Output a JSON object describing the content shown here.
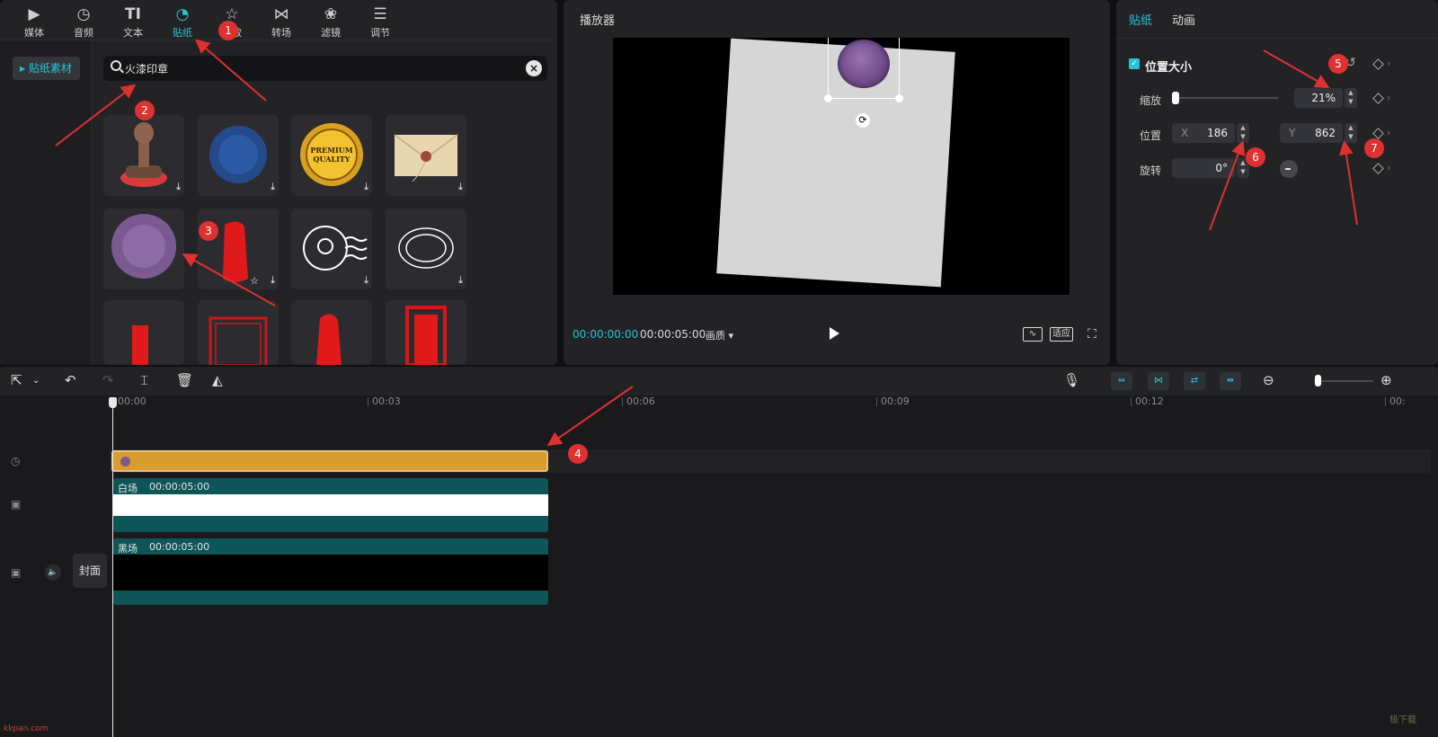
{
  "top_tabs": [
    {
      "label": "媒体",
      "icon": "media-icon"
    },
    {
      "label": "音频",
      "icon": "audio-icon"
    },
    {
      "label": "文本",
      "icon": "text-icon"
    },
    {
      "label": "贴纸",
      "icon": "sticker-icon"
    },
    {
      "label": "特效",
      "icon": "effects-icon"
    },
    {
      "label": "转场",
      "icon": "transition-icon"
    },
    {
      "label": "滤镜",
      "icon": "filter-icon"
    },
    {
      "label": "调节",
      "icon": "adjust-icon"
    }
  ],
  "sidebar": {
    "active_item": "▸ 贴纸素材"
  },
  "search": {
    "value": "火漆印章"
  },
  "sticker_grid": {
    "premium_text_1": "PREMIUM",
    "premium_text_2": "QUALITY"
  },
  "player": {
    "title": "播放器",
    "current_time": "00:00:00:00",
    "total_time": "00:00:05:00",
    "quality_label": "画质 ▾",
    "fit_label": "适应"
  },
  "properties": {
    "tabs": [
      "贴纸",
      "动画"
    ],
    "section_title": "位置大小",
    "scale_label": "缩放",
    "scale_value": "21%",
    "position_label": "位置",
    "x_label": "X",
    "x_value": "186",
    "y_label": "Y",
    "y_value": "862",
    "rotation_label": "旋转",
    "rotation_value": "0°"
  },
  "timeline": {
    "ruler": [
      "00:00",
      "00:03",
      "00:06",
      "00:09",
      "00:12",
      "00:"
    ],
    "clips": [
      {
        "label": "白场",
        "duration": "00:00:05:00"
      },
      {
        "label": "黑场",
        "duration": "00:00:05:00"
      }
    ],
    "cover_label": "封面"
  },
  "annotations": [
    "1",
    "2",
    "3",
    "4",
    "5",
    "6",
    "7"
  ],
  "watermark": "极下载",
  "watermark_left": "kkpan.com",
  "colors": {
    "accent": "#27c3d6",
    "annotation": "#e03131",
    "sticker_clip": "#d99c2e",
    "video_clip": "#0d5558"
  }
}
